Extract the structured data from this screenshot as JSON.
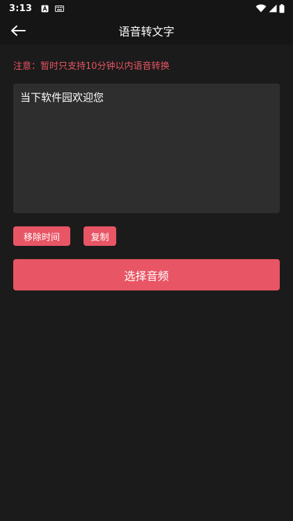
{
  "status_bar": {
    "time": "3:13",
    "left_icons": [
      "font-a-icon",
      "keyboard-icon"
    ],
    "right_icons": [
      "wifi-icon",
      "signal-icon",
      "battery-icon"
    ]
  },
  "app_bar": {
    "title": "语音转文字",
    "back_icon": "arrow-left-icon"
  },
  "notice": {
    "text": "注意：暂时只支持10分钟以内语音转换"
  },
  "transcript": {
    "text": "当下软件园欢迎您"
  },
  "actions": {
    "remove_time_label": "移除时间",
    "copy_label": "复制",
    "select_audio_label": "选择音频"
  },
  "colors": {
    "background": "#1b1b1b",
    "bar": "#151515",
    "accent": "#e85564",
    "textarea": "#2e2e2e"
  }
}
